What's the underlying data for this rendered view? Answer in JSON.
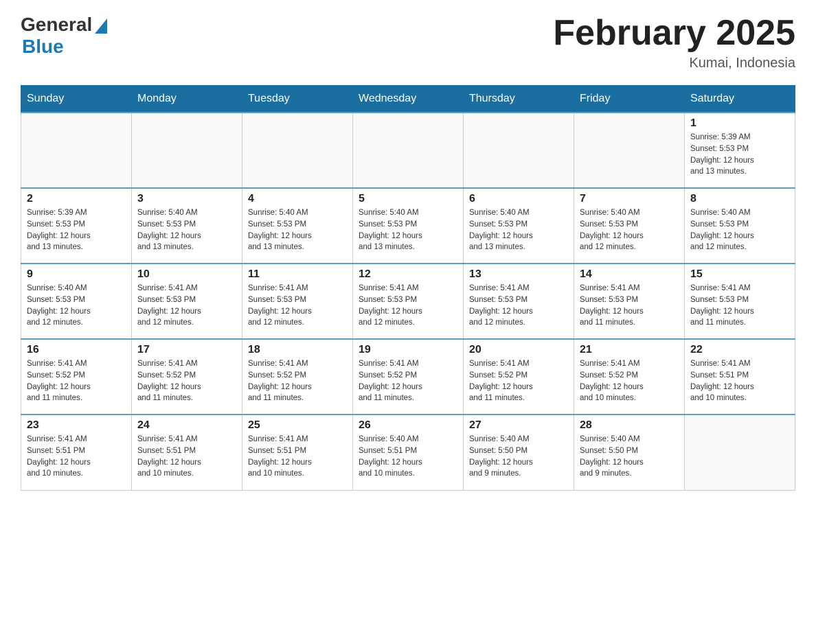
{
  "logo": {
    "general": "General",
    "blue": "Blue"
  },
  "title": "February 2025",
  "location": "Kumai, Indonesia",
  "days_header": [
    "Sunday",
    "Monday",
    "Tuesday",
    "Wednesday",
    "Thursday",
    "Friday",
    "Saturday"
  ],
  "weeks": [
    [
      {
        "day": "",
        "info": ""
      },
      {
        "day": "",
        "info": ""
      },
      {
        "day": "",
        "info": ""
      },
      {
        "day": "",
        "info": ""
      },
      {
        "day": "",
        "info": ""
      },
      {
        "day": "",
        "info": ""
      },
      {
        "day": "1",
        "info": "Sunrise: 5:39 AM\nSunset: 5:53 PM\nDaylight: 12 hours\nand 13 minutes."
      }
    ],
    [
      {
        "day": "2",
        "info": "Sunrise: 5:39 AM\nSunset: 5:53 PM\nDaylight: 12 hours\nand 13 minutes."
      },
      {
        "day": "3",
        "info": "Sunrise: 5:40 AM\nSunset: 5:53 PM\nDaylight: 12 hours\nand 13 minutes."
      },
      {
        "day": "4",
        "info": "Sunrise: 5:40 AM\nSunset: 5:53 PM\nDaylight: 12 hours\nand 13 minutes."
      },
      {
        "day": "5",
        "info": "Sunrise: 5:40 AM\nSunset: 5:53 PM\nDaylight: 12 hours\nand 13 minutes."
      },
      {
        "day": "6",
        "info": "Sunrise: 5:40 AM\nSunset: 5:53 PM\nDaylight: 12 hours\nand 13 minutes."
      },
      {
        "day": "7",
        "info": "Sunrise: 5:40 AM\nSunset: 5:53 PM\nDaylight: 12 hours\nand 12 minutes."
      },
      {
        "day": "8",
        "info": "Sunrise: 5:40 AM\nSunset: 5:53 PM\nDaylight: 12 hours\nand 12 minutes."
      }
    ],
    [
      {
        "day": "9",
        "info": "Sunrise: 5:40 AM\nSunset: 5:53 PM\nDaylight: 12 hours\nand 12 minutes."
      },
      {
        "day": "10",
        "info": "Sunrise: 5:41 AM\nSunset: 5:53 PM\nDaylight: 12 hours\nand 12 minutes."
      },
      {
        "day": "11",
        "info": "Sunrise: 5:41 AM\nSunset: 5:53 PM\nDaylight: 12 hours\nand 12 minutes."
      },
      {
        "day": "12",
        "info": "Sunrise: 5:41 AM\nSunset: 5:53 PM\nDaylight: 12 hours\nand 12 minutes."
      },
      {
        "day": "13",
        "info": "Sunrise: 5:41 AM\nSunset: 5:53 PM\nDaylight: 12 hours\nand 12 minutes."
      },
      {
        "day": "14",
        "info": "Sunrise: 5:41 AM\nSunset: 5:53 PM\nDaylight: 12 hours\nand 11 minutes."
      },
      {
        "day": "15",
        "info": "Sunrise: 5:41 AM\nSunset: 5:53 PM\nDaylight: 12 hours\nand 11 minutes."
      }
    ],
    [
      {
        "day": "16",
        "info": "Sunrise: 5:41 AM\nSunset: 5:52 PM\nDaylight: 12 hours\nand 11 minutes."
      },
      {
        "day": "17",
        "info": "Sunrise: 5:41 AM\nSunset: 5:52 PM\nDaylight: 12 hours\nand 11 minutes."
      },
      {
        "day": "18",
        "info": "Sunrise: 5:41 AM\nSunset: 5:52 PM\nDaylight: 12 hours\nand 11 minutes."
      },
      {
        "day": "19",
        "info": "Sunrise: 5:41 AM\nSunset: 5:52 PM\nDaylight: 12 hours\nand 11 minutes."
      },
      {
        "day": "20",
        "info": "Sunrise: 5:41 AM\nSunset: 5:52 PM\nDaylight: 12 hours\nand 11 minutes."
      },
      {
        "day": "21",
        "info": "Sunrise: 5:41 AM\nSunset: 5:52 PM\nDaylight: 12 hours\nand 10 minutes."
      },
      {
        "day": "22",
        "info": "Sunrise: 5:41 AM\nSunset: 5:51 PM\nDaylight: 12 hours\nand 10 minutes."
      }
    ],
    [
      {
        "day": "23",
        "info": "Sunrise: 5:41 AM\nSunset: 5:51 PM\nDaylight: 12 hours\nand 10 minutes."
      },
      {
        "day": "24",
        "info": "Sunrise: 5:41 AM\nSunset: 5:51 PM\nDaylight: 12 hours\nand 10 minutes."
      },
      {
        "day": "25",
        "info": "Sunrise: 5:41 AM\nSunset: 5:51 PM\nDaylight: 12 hours\nand 10 minutes."
      },
      {
        "day": "26",
        "info": "Sunrise: 5:40 AM\nSunset: 5:51 PM\nDaylight: 12 hours\nand 10 minutes."
      },
      {
        "day": "27",
        "info": "Sunrise: 5:40 AM\nSunset: 5:50 PM\nDaylight: 12 hours\nand 9 minutes."
      },
      {
        "day": "28",
        "info": "Sunrise: 5:40 AM\nSunset: 5:50 PM\nDaylight: 12 hours\nand 9 minutes."
      },
      {
        "day": "",
        "info": ""
      }
    ]
  ]
}
